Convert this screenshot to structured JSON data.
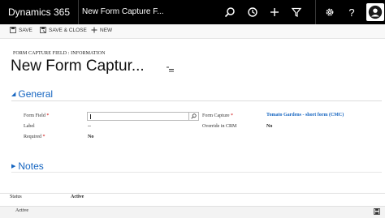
{
  "app": {
    "brand": "Dynamics 365",
    "record_title": "New Form Capture F..."
  },
  "topbar": {
    "icons": [
      "search-icon",
      "history-icon",
      "plus-icon",
      "filter-icon",
      "gear-icon",
      "help-icon",
      "user-avatar-icon"
    ]
  },
  "commands": {
    "save": "SAVE",
    "save_close": "SAVE & CLOSE",
    "new": "NEW"
  },
  "header": {
    "entity": "FORM CAPTURE FIELD : INFORMATION",
    "title": "New Form Captur..."
  },
  "sections": {
    "general": "General",
    "notes": "Notes"
  },
  "fields": {
    "form_field": {
      "label": "Form Field",
      "value": ""
    },
    "label": {
      "label": "Label",
      "value": "--"
    },
    "required": {
      "label": "Required",
      "value": "No"
    },
    "form_capture": {
      "label": "Form Capture",
      "value": "Tomato Gardens - short form (CMC)"
    },
    "override": {
      "label": "Override in CRM",
      "value": "No"
    }
  },
  "footer": {
    "status_label": "Status",
    "status_value": "Active",
    "state": "Active"
  },
  "colors": {
    "topbar": "#000000",
    "accent": "#1565c0",
    "required": "#cc0000"
  }
}
